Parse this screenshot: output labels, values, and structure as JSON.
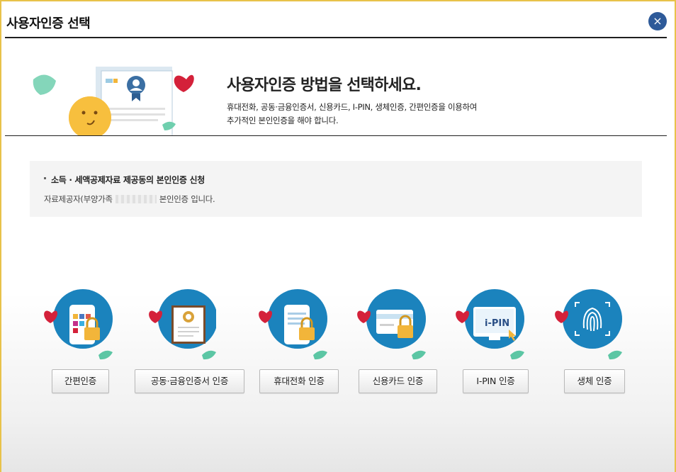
{
  "title": "사용자인증 선택",
  "close_symbol": "×",
  "hero": {
    "heading": "사용자인증 방법을 선택하세요.",
    "desc_line1": "휴대전화, 공동·금융인증서, 신용카드, I-PIN, 생체인증, 간편인증을 이용하여",
    "desc_line2": "추가적인 본인인증을 해야 합니다."
  },
  "notice": {
    "title": "소득 · 세액공제자료 제공동의 본인인증 신청",
    "sub_before": "자료제공자(부양가족",
    "sub_after": "본인인증 입니다."
  },
  "methods": [
    {
      "label": "간편인증",
      "icon": "simple-auth-icon"
    },
    {
      "label": "공동·금융인증서 인증",
      "icon": "certificate-icon"
    },
    {
      "label": "휴대전화 인증",
      "icon": "mobile-phone-icon"
    },
    {
      "label": "신용카드 인증",
      "icon": "credit-card-icon"
    },
    {
      "label": "I-PIN 인증",
      "icon": "ipin-icon",
      "icon_text": "i-PIN"
    },
    {
      "label": "생체 인증",
      "icon": "fingerprint-icon"
    }
  ],
  "colors": {
    "close": "#2e5a99",
    "heart": "#d4213a",
    "circle": "#1f8fc7",
    "leaf": "#5cc6a4"
  }
}
